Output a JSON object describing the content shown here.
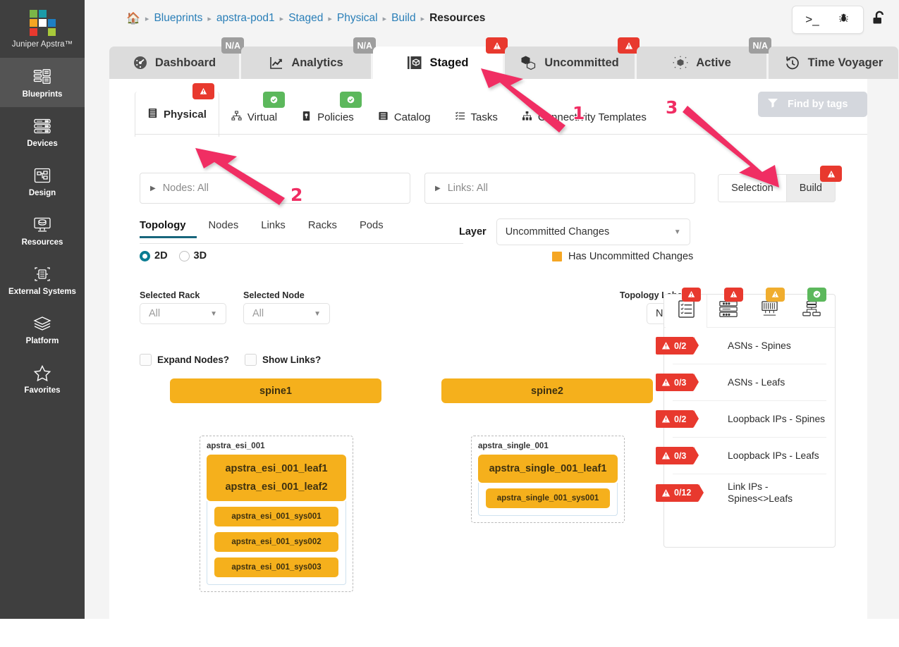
{
  "sidebar": {
    "brand": "Juniper Apstra™",
    "logo_colors": [
      "#7ab648",
      "#1a9ba8",
      "",
      "#f5a623",
      "#ffffff",
      "#1d7fc3",
      "#e8392e",
      "",
      "#a8c93a"
    ],
    "items": [
      {
        "label": "Blueprints",
        "icon": "blueprints-icon",
        "active": true
      },
      {
        "label": "Devices",
        "icon": "devices-icon",
        "active": false
      },
      {
        "label": "Design",
        "icon": "design-icon",
        "active": false
      },
      {
        "label": "Resources",
        "icon": "resources-icon",
        "active": false
      },
      {
        "label": "External Systems",
        "icon": "external-systems-icon",
        "active": false
      },
      {
        "label": "Platform",
        "icon": "platform-icon",
        "active": false
      },
      {
        "label": "Favorites",
        "icon": "star-icon",
        "active": false
      }
    ]
  },
  "breadcrumb": {
    "star_icon": "star-outline-icon",
    "home_icon": "home-icon",
    "items": [
      "Blueprints",
      "apstra-pod1",
      "Staged",
      "Physical",
      "Build"
    ],
    "current": "Resources",
    "separator": "▸"
  },
  "topright": {
    "terminal_icon": ">_",
    "bug_icon": "bug-icon",
    "lock_icon": "unlock-icon"
  },
  "tabs": [
    {
      "label": "Dashboard",
      "icon": "gauge-icon",
      "badge": "N/A",
      "badge_type": "na",
      "active": false
    },
    {
      "label": "Analytics",
      "icon": "chart-line-icon",
      "badge": "N/A",
      "badge_type": "na",
      "active": false
    },
    {
      "label": "Staged",
      "icon": "cube-box-icon",
      "badge": "⚠",
      "badge_type": "err",
      "active": true
    },
    {
      "label": "Uncommitted",
      "icon": "cubes-icon",
      "badge": "⚠",
      "badge_type": "err",
      "active": false
    },
    {
      "label": "Active",
      "icon": "active-cube-icon",
      "badge": "N/A",
      "badge_type": "na",
      "active": false
    },
    {
      "label": "Time Voyager",
      "icon": "clock-rewind-icon",
      "badge": "",
      "badge_type": "none",
      "active": false
    }
  ],
  "subtabs": [
    {
      "label": "Physical",
      "icon": "rack-icon",
      "badge": "⚠",
      "badge_type": "err",
      "active": true
    },
    {
      "label": "Virtual",
      "icon": "virtual-net-icon",
      "badge": "✓",
      "badge_type": "ok",
      "active": false
    },
    {
      "label": "Policies",
      "icon": "policy-icon",
      "badge": "✓",
      "badge_type": "ok",
      "active": false
    },
    {
      "label": "Catalog",
      "icon": "catalog-icon",
      "badge": "",
      "badge_type": "none",
      "active": false
    },
    {
      "label": "Tasks",
      "icon": "tasks-icon",
      "badge": "",
      "badge_type": "none",
      "active": false
    },
    {
      "label": "Connectivity Templates",
      "icon": "connectivity-icon",
      "badge": "",
      "badge_type": "none",
      "active": false
    }
  ],
  "find_by_tags": {
    "label": "Find by tags",
    "icon": "filter-funnel-icon"
  },
  "filters": {
    "nodes": "Nodes: All",
    "links": "Links: All"
  },
  "side_tabs": [
    {
      "label": "Selection",
      "active": false,
      "badge": "",
      "badge_type": "none"
    },
    {
      "label": "Build",
      "active": true,
      "badge": "⚠",
      "badge_type": "err"
    }
  ],
  "topology_tabs": [
    {
      "label": "Topology",
      "active": true
    },
    {
      "label": "Nodes",
      "active": false
    },
    {
      "label": "Links",
      "active": false
    },
    {
      "label": "Racks",
      "active": false
    },
    {
      "label": "Pods",
      "active": false
    }
  ],
  "dimension": {
    "options": [
      "2D",
      "3D"
    ],
    "selected": "2D"
  },
  "layer": {
    "label": "Layer",
    "value": "Uncommitted Changes",
    "legend_label": "Has Uncommitted Changes",
    "legend_color": "#f5a623"
  },
  "selectors": {
    "rack_label": "Selected Rack",
    "rack_value": "All",
    "node_label": "Selected Node",
    "node_value": "All",
    "topology_label_label": "Topology Label",
    "topology_label_value": "Name"
  },
  "checkboxes": [
    {
      "label": "Expand Nodes?",
      "checked": false
    },
    {
      "label": "Show Links?",
      "checked": false
    }
  ],
  "topology": {
    "spines": [
      "spine1",
      "spine2"
    ],
    "racks": [
      {
        "name": "apstra_esi_001",
        "leafs": [
          "apstra_esi_001_leaf1",
          "apstra_esi_001_leaf2"
        ],
        "systems": [
          "apstra_esi_001_sys001",
          "apstra_esi_001_sys002",
          "apstra_esi_001_sys003"
        ]
      },
      {
        "name": "apstra_single_001",
        "leafs": [
          "apstra_single_001_leaf1"
        ],
        "systems": [
          "apstra_single_001_sys001"
        ]
      }
    ],
    "node_color": "#f5b01c"
  },
  "build_panel": {
    "tabs": [
      {
        "icon": "checklist-icon",
        "badge": "⚠",
        "badge_type": "err",
        "active": true
      },
      {
        "icon": "server-rack-icon",
        "badge": "⚠",
        "badge_type": "err",
        "active": false
      },
      {
        "icon": "device-icon",
        "badge": "⚠",
        "badge_type": "warn",
        "active": false
      },
      {
        "icon": "network-icon",
        "badge": "✓",
        "badge_type": "ok",
        "active": false
      }
    ],
    "rows": [
      {
        "count": "0/2",
        "name": "ASNs - Spines",
        "status": "error"
      },
      {
        "count": "0/3",
        "name": "ASNs - Leafs",
        "status": "error"
      },
      {
        "count": "0/2",
        "name": "Loopback IPs - Spines",
        "status": "error"
      },
      {
        "count": "0/3",
        "name": "Loopback IPs - Leafs",
        "status": "error"
      },
      {
        "count": "0/12",
        "name": "Link IPs - Spines<>Leafs",
        "status": "error"
      }
    ]
  },
  "annotations": [
    {
      "number": "1",
      "target": "staged-tab"
    },
    {
      "number": "2",
      "target": "physical-subtab"
    },
    {
      "number": "3",
      "target": "build-tab"
    }
  ],
  "colors": {
    "accent_blue": "#2a7fb8",
    "error_red": "#e8392e",
    "ok_green": "#5cb85c",
    "warn_orange": "#f0ad2e",
    "node_amber": "#f5b01c",
    "annotation_pink": "#f02d63",
    "sidebar_bg": "#3f3f3f"
  }
}
